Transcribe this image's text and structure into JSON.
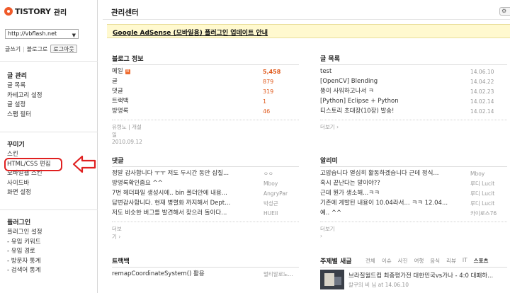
{
  "brand": {
    "logo": "TISTORY",
    "logo_sub": "관리"
  },
  "sidebar": {
    "blog_select_value": "http://vbflash.net",
    "links": {
      "write": "글쓰기",
      "blog_home": "블로그로",
      "logout": "로그아웃"
    },
    "sections": [
      {
        "title": "글 관리",
        "items": [
          "글 목록",
          "카테고리 설정",
          "글 설정",
          "스팸 필터"
        ]
      },
      {
        "title": "꾸미기",
        "items": [
          "스킨",
          "HTML/CSS 편집",
          "모바일웹 스킨",
          "사이드바",
          "화면 설정"
        ]
      },
      {
        "title": "플러그인",
        "items": [
          "플러그인 설정",
          "- 유입 키워드",
          "- 유입 경로",
          "- 방문자 통계",
          "- 검색어 통계"
        ]
      }
    ]
  },
  "main": {
    "title": "관리센터",
    "notice": "Google AdSense (모바일용) 플러그인 업데이트 안내",
    "stats": {
      "title": "블로그 정보",
      "rows": [
        {
          "label": "메일",
          "new": "N",
          "value": "5,458"
        },
        {
          "label": "글",
          "value": "879"
        },
        {
          "label": "댓글",
          "value": "319"
        },
        {
          "label": "트랙백",
          "value": "1"
        },
        {
          "label": "방명록",
          "value": "46"
        }
      ],
      "footer": "유령노 | 개설일 2010.09.12"
    },
    "posts": {
      "title": "글 목록",
      "rows": [
        {
          "title": "test",
          "date": "14.06.10"
        },
        {
          "title": "[OpenCV] Blending",
          "date": "14.04.22"
        },
        {
          "title": "뚱이 사워하고나서 ㅋ",
          "date": "14.02.23"
        },
        {
          "title": "[Python] Eclipse + Python",
          "date": "14.02.14"
        },
        {
          "title": "티스토리 초대장(10장) 발송!",
          "date": "14.02.14"
        }
      ],
      "more": "더보기 ›"
    },
    "comments": {
      "title": "댓글",
      "rows": [
        {
          "text": "정말 감사합니다 ㅜㅜ 저도 두시간 동안 삽질...",
          "author": "ㅇㅇ"
        },
        {
          "text": "방명록확인좀요 ^^",
          "author": "Mboy"
        },
        {
          "text": "7번 헤더파일 생성시에.. bin 폴더안에 내용...",
          "author": "AngryPar"
        },
        {
          "text": "답변감사합니다. 현재 병렬화 까지해서 Dept...",
          "author": "박성근"
        },
        {
          "text": "저도 비슷한 버그를 발견해서 찾으러 돌아다...",
          "author": "HUEII"
        }
      ],
      "more": "더보기 ›"
    },
    "alerts": {
      "title": "알리미",
      "rows": [
        {
          "text": "고맙습니다 열심히 활동하겠습니다 근데 정식...",
          "author": "Mboy"
        },
        {
          "text": "혹시 끝난다는 말이야??",
          "author": "루디 Lucit"
        },
        {
          "text": "근데 뭔가 생소해...ㅋㅋ",
          "author": "루디 Lucit"
        },
        {
          "text": "기존에 게발된 내용이 10.04라서... ㅋㅋ 12.04...",
          "author": "루디 Lucit"
        },
        {
          "text": "예.. ^^",
          "author": "카이로스76"
        }
      ],
      "more": "더보기 ›"
    },
    "trackback": {
      "title": "트랙백",
      "rows": [
        {
          "text": "remapCoordinateSystem() 활용",
          "author": "멀티알로노..."
        }
      ]
    },
    "topics": {
      "title": "주제별 새글",
      "tabs": [
        "전체",
        "이슈",
        "사진",
        "여행",
        "음식",
        "리뷰",
        "IT",
        "스포츠"
      ],
      "active_tab": "스포츠",
      "item": {
        "title": "브라질월드컵 최종평가전 대한민국vs가나 - 4:0 대패하...",
        "meta": "칼쿠의 비 님 at 14.06.10"
      }
    }
  },
  "colors": {
    "accent": "#e05a1c",
    "annotation_red": "#e02020",
    "notice_bg": "#fff9cf"
  }
}
